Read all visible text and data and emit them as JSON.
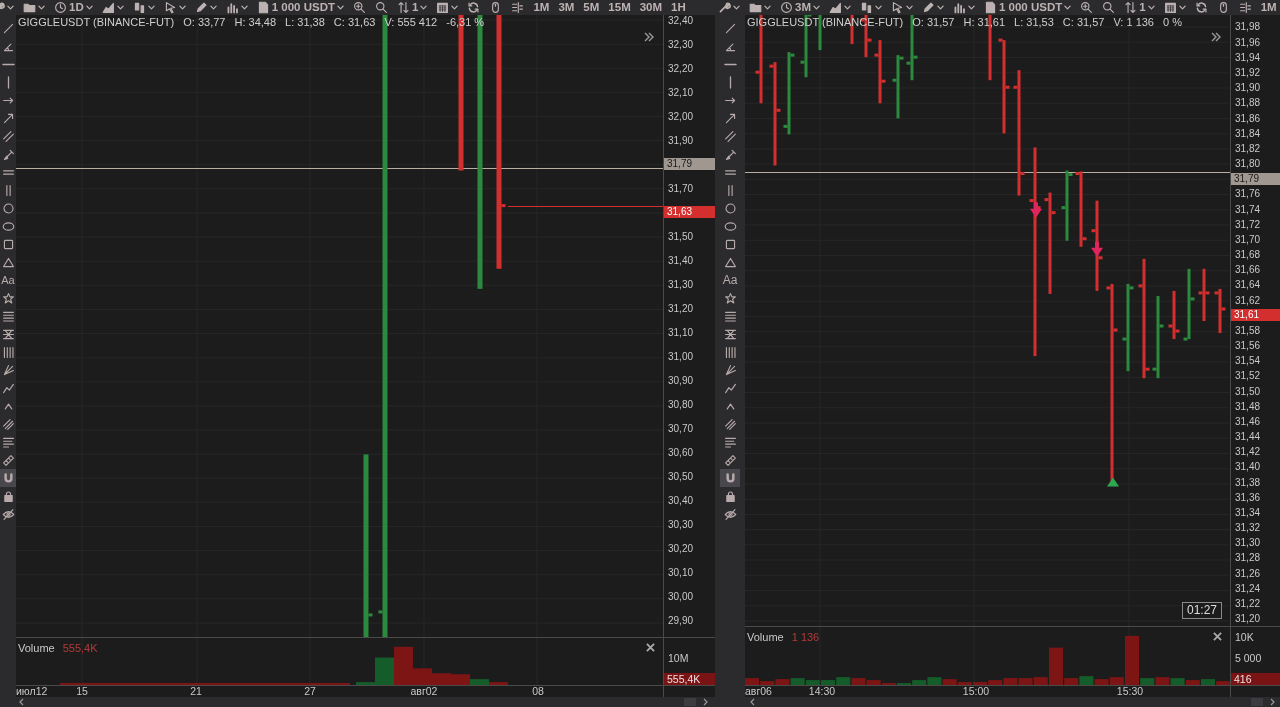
{
  "panels": [
    {
      "toolbar": [
        {
          "kind": "wrench",
          "dropdown": true
        },
        {
          "kind": "folder",
          "dropdown": true
        },
        {
          "kind": "clock",
          "label": "1D",
          "dropdown": true
        },
        {
          "kind": "area",
          "dropdown": true
        },
        {
          "kind": "bars",
          "dropdown": true
        },
        {
          "kind": "cursor",
          "dropdown": true
        },
        {
          "kind": "pencil",
          "dropdown": true
        },
        {
          "kind": "volume",
          "dropdown": true
        },
        {
          "kind": "document",
          "label": "1 000 USDT",
          "dropdown": true
        },
        {
          "kind": "zoom-in",
          "dropdown": false
        },
        {
          "kind": "search",
          "dropdown": false
        },
        {
          "kind": "sort",
          "label": "1",
          "dropdown": true
        },
        {
          "kind": "calendar",
          "dropdown": true
        },
        {
          "kind": "refresh",
          "dropdown": false
        },
        {
          "kind": "mouse",
          "dropdown": false
        },
        {
          "kind": "split",
          "dropdown": false
        },
        {
          "kind": "timeframe",
          "label": "1M",
          "selected": false
        },
        {
          "kind": "timeframe",
          "label": "3M",
          "selected": false
        },
        {
          "kind": "timeframe",
          "label": "5M",
          "selected": false
        },
        {
          "kind": "timeframe",
          "label": "15M",
          "selected": false
        },
        {
          "kind": "timeframe",
          "label": "30M",
          "selected": false
        },
        {
          "kind": "timeframe",
          "label": "1H",
          "selected": false
        }
      ],
      "tools": [
        {
          "kind": "trendline",
          "selected": false
        },
        {
          "kind": "angle",
          "selected": false
        },
        {
          "kind": "hline",
          "selected": false
        },
        {
          "kind": "vline",
          "selected": false
        },
        {
          "kind": "ray",
          "selected": false
        },
        {
          "kind": "arrow",
          "selected": false
        },
        {
          "kind": "parallel",
          "selected": false
        },
        {
          "kind": "brush",
          "selected": false
        },
        {
          "kind": "doubleh",
          "selected": false
        },
        {
          "kind": "doublev",
          "selected": false
        },
        {
          "kind": "circle",
          "selected": false
        },
        {
          "kind": "ellipse",
          "selected": false
        },
        {
          "kind": "rect",
          "selected": false
        },
        {
          "kind": "triangle",
          "selected": false
        },
        {
          "kind": "text",
          "label": "Aa",
          "selected": false
        },
        {
          "kind": "star",
          "selected": false
        },
        {
          "kind": "lines4",
          "selected": false
        },
        {
          "kind": "fib",
          "selected": false
        },
        {
          "kind": "vlines4",
          "selected": false
        },
        {
          "kind": "pitchfork",
          "selected": false
        },
        {
          "kind": "zigzag",
          "selected": false
        },
        {
          "kind": "caret",
          "selected": false
        },
        {
          "kind": "hatch",
          "selected": false
        },
        {
          "kind": "align",
          "selected": false
        },
        {
          "kind": "ruler",
          "selected": false
        },
        {
          "kind": "magnet",
          "selected": true
        },
        {
          "kind": "lock",
          "selected": false
        },
        {
          "kind": "eyeoff",
          "selected": false
        }
      ],
      "info": {
        "symbol": "GIGGLEUSDT (BINANCE-FUT)",
        "values": [
          "O: 33,77",
          "H: 34,48",
          "L: 31,38",
          "C: 31,63",
          "V: 555 412",
          "-6,31 %"
        ]
      },
      "price_axis": [
        {
          "text": "32,40",
          "kind": "tick"
        },
        {
          "text": "32,30",
          "kind": "tick"
        },
        {
          "text": "32,20",
          "kind": "tick"
        },
        {
          "text": "32,10",
          "kind": "tick"
        },
        {
          "text": "32,00",
          "kind": "tick"
        },
        {
          "text": "31,90",
          "kind": "tick"
        },
        {
          "text": "31,79",
          "kind": "crosshair"
        },
        {
          "text": "31,70",
          "kind": "tick"
        },
        {
          "text": "31,63",
          "kind": "last"
        },
        {
          "text": "31,50",
          "kind": "tick"
        },
        {
          "text": "31,40",
          "kind": "tick"
        },
        {
          "text": "31,30",
          "kind": "tick"
        },
        {
          "text": "31,20",
          "kind": "tick"
        },
        {
          "text": "31,10",
          "kind": "tick"
        },
        {
          "text": "31,00",
          "kind": "tick"
        },
        {
          "text": "30,90",
          "kind": "tick"
        },
        {
          "text": "30,80",
          "kind": "tick"
        },
        {
          "text": "30,70",
          "kind": "tick"
        },
        {
          "text": "30,60",
          "kind": "tick"
        },
        {
          "text": "30,50",
          "kind": "tick"
        },
        {
          "text": "30,40",
          "kind": "tick"
        },
        {
          "text": "30,30",
          "kind": "tick"
        },
        {
          "text": "30,20",
          "kind": "tick"
        },
        {
          "text": "30,10",
          "kind": "tick"
        },
        {
          "text": "30,00",
          "kind": "tick"
        },
        {
          "text": "29,90",
          "kind": "tick"
        }
      ],
      "volume": {
        "title": "Volume",
        "value": "555,4K",
        "axis": [
          {
            "text": "10M",
            "kind": "tick"
          },
          {
            "text": "555,4K",
            "kind": "last"
          }
        ]
      },
      "time_axis": [
        "июл12",
        "15",
        "21",
        "27",
        "авг02",
        "08"
      ]
    },
    {
      "toolbar": [
        {
          "kind": "wrench",
          "dropdown": true
        },
        {
          "kind": "folder",
          "dropdown": true
        },
        {
          "kind": "clock",
          "label": "3M",
          "dropdown": true
        },
        {
          "kind": "area",
          "dropdown": true
        },
        {
          "kind": "bars",
          "dropdown": true
        },
        {
          "kind": "cursor",
          "dropdown": true
        },
        {
          "kind": "pencil",
          "dropdown": true
        },
        {
          "kind": "volume",
          "dropdown": true
        },
        {
          "kind": "document",
          "label": "1 000 USDT",
          "dropdown": true
        },
        {
          "kind": "zoom-in",
          "dropdown": false
        },
        {
          "kind": "search",
          "dropdown": false
        },
        {
          "kind": "sort",
          "label": "1",
          "dropdown": true
        },
        {
          "kind": "calendar",
          "dropdown": true
        },
        {
          "kind": "refresh",
          "dropdown": false
        },
        {
          "kind": "mouse",
          "dropdown": false
        },
        {
          "kind": "split",
          "dropdown": false
        },
        {
          "kind": "timeframe",
          "label": "1M",
          "selected": false
        }
      ],
      "tools": [
        {
          "kind": "trendline",
          "selected": false
        },
        {
          "kind": "angle",
          "selected": false
        },
        {
          "kind": "hline",
          "selected": false
        },
        {
          "kind": "vline",
          "selected": false
        },
        {
          "kind": "ray",
          "selected": false
        },
        {
          "kind": "arrow",
          "selected": false
        },
        {
          "kind": "parallel",
          "selected": false
        },
        {
          "kind": "brush",
          "selected": false
        },
        {
          "kind": "doubleh",
          "selected": false
        },
        {
          "kind": "doublev",
          "selected": false
        },
        {
          "kind": "circle",
          "selected": false
        },
        {
          "kind": "ellipse",
          "selected": false
        },
        {
          "kind": "rect",
          "selected": false
        },
        {
          "kind": "triangle",
          "selected": false
        },
        {
          "kind": "text",
          "label": "Aa",
          "selected": false
        },
        {
          "kind": "star",
          "selected": false
        },
        {
          "kind": "lines4",
          "selected": false
        },
        {
          "kind": "fib",
          "selected": false
        },
        {
          "kind": "vlines4",
          "selected": false
        },
        {
          "kind": "pitchfork",
          "selected": false
        },
        {
          "kind": "zigzag",
          "selected": false
        },
        {
          "kind": "caret",
          "selected": false
        },
        {
          "kind": "hatch",
          "selected": false
        },
        {
          "kind": "align",
          "selected": false
        },
        {
          "kind": "ruler",
          "selected": false
        },
        {
          "kind": "magnet",
          "selected": true
        },
        {
          "kind": "lock",
          "selected": false
        },
        {
          "kind": "eyeoff",
          "selected": false
        }
      ],
      "info": {
        "symbol": "GIGGLEUSDT (BINANCE-FUT)",
        "values": [
          "O: 31,57",
          "H: 31,61",
          "L: 31,53",
          "C: 31,57",
          "V: 1 136",
          "0 %"
        ]
      },
      "price_axis": [
        {
          "text": "31,98",
          "kind": "tick"
        },
        {
          "text": "31,96",
          "kind": "tick"
        },
        {
          "text": "31,94",
          "kind": "tick"
        },
        {
          "text": "31,92",
          "kind": "tick"
        },
        {
          "text": "31,90",
          "kind": "tick"
        },
        {
          "text": "31,88",
          "kind": "tick"
        },
        {
          "text": "31,86",
          "kind": "tick"
        },
        {
          "text": "31,84",
          "kind": "tick"
        },
        {
          "text": "31,82",
          "kind": "tick"
        },
        {
          "text": "31,80",
          "kind": "tick"
        },
        {
          "text": "31,79",
          "kind": "crosshair"
        },
        {
          "text": "31,76",
          "kind": "tick"
        },
        {
          "text": "31,74",
          "kind": "tick"
        },
        {
          "text": "31,72",
          "kind": "tick"
        },
        {
          "text": "31,70",
          "kind": "tick"
        },
        {
          "text": "31,68",
          "kind": "tick"
        },
        {
          "text": "31,66",
          "kind": "tick"
        },
        {
          "text": "31,64",
          "kind": "tick"
        },
        {
          "text": "31,62",
          "kind": "tick"
        },
        {
          "text": "31,61",
          "kind": "last"
        },
        {
          "text": "31,58",
          "kind": "tick"
        },
        {
          "text": "31,56",
          "kind": "tick"
        },
        {
          "text": "31,54",
          "kind": "tick"
        },
        {
          "text": "31,52",
          "kind": "tick"
        },
        {
          "text": "31,50",
          "kind": "tick"
        },
        {
          "text": "31,48",
          "kind": "tick"
        },
        {
          "text": "31,46",
          "kind": "tick"
        },
        {
          "text": "31,44",
          "kind": "tick"
        },
        {
          "text": "31,42",
          "kind": "tick"
        },
        {
          "text": "31,40",
          "kind": "tick"
        },
        {
          "text": "31,38",
          "kind": "tick"
        },
        {
          "text": "31,36",
          "kind": "tick"
        },
        {
          "text": "31,34",
          "kind": "tick"
        },
        {
          "text": "31,32",
          "kind": "tick"
        },
        {
          "text": "31,30",
          "kind": "tick"
        },
        {
          "text": "31,28",
          "kind": "tick"
        },
        {
          "text": "31,26",
          "kind": "tick"
        },
        {
          "text": "31,24",
          "kind": "tick"
        },
        {
          "text": "31,22",
          "kind": "tick"
        },
        {
          "text": "31,20",
          "kind": "tick"
        }
      ],
      "volume": {
        "title": "Volume",
        "value": "1 136",
        "axis": [
          {
            "text": "10K",
            "kind": "tick"
          },
          {
            "text": "5 000",
            "kind": "tick"
          },
          {
            "text": "416",
            "kind": "last"
          }
        ]
      },
      "time_axis": [
        "авг06",
        "14:30",
        "15:00",
        "15:30"
      ],
      "timer": "01:27"
    }
  ]
}
